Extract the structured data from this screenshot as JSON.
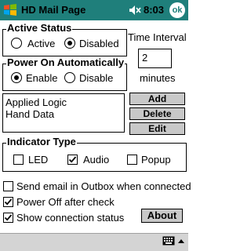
{
  "titlebar": {
    "title": "HD Mail Page",
    "time": "8:03",
    "ok_label": "ok",
    "color": "#1f7f7b",
    "start_icon": "windows-logo-icon",
    "volume_icon": "speaker-muted-icon"
  },
  "active_status": {
    "legend": "Active Status",
    "active_label": "Active",
    "disabled_label": "Disabled",
    "selected": "Disabled"
  },
  "time_interval": {
    "label": "Time Interval",
    "value": "2",
    "unit": "minutes"
  },
  "power_on": {
    "legend": "Power On Automatically",
    "enable_label": "Enable",
    "disable_label": "Disable",
    "selected": "Enable"
  },
  "list": {
    "items": [
      "Applied Logic",
      "Hand Data"
    ]
  },
  "buttons": {
    "add": "Add",
    "delete": "Delete",
    "edit": "Edit",
    "about": "About"
  },
  "indicator": {
    "legend": "Indicator Type",
    "led_label": "LED",
    "led_checked": false,
    "audio_label": "Audio",
    "audio_checked": true,
    "popup_label": "Popup",
    "popup_checked": false
  },
  "options": {
    "send_outbox_label": "Send email in Outbox when connected",
    "send_outbox_checked": false,
    "power_off_label": "Power Off after check",
    "power_off_checked": true,
    "show_status_label": "Show connection status",
    "show_status_checked": true
  },
  "menubar": {
    "keyboard_icon": "keyboard-icon",
    "arrow_icon": "up-arrow-icon"
  }
}
